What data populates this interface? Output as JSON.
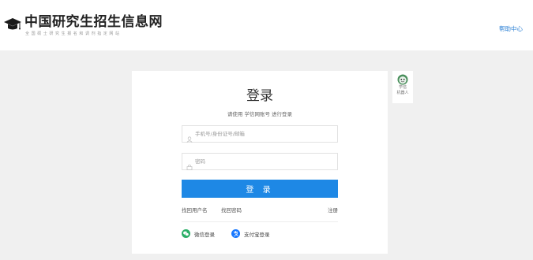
{
  "header": {
    "logo_title": "中国研究生招生信息网",
    "logo_subtitle": "全国硕士研究生报名和调剂指定网站",
    "help_link": "帮助中心"
  },
  "login": {
    "title": "登录",
    "subtitle": "请使用 学信网账号 进行登录",
    "username_placeholder": "手机号/身份证号/邮箱",
    "password_placeholder": "密码",
    "login_button": "登 录",
    "find_username": "找回用户名",
    "find_password": "找回密码",
    "register": "注册",
    "wechat_login": "微信登录",
    "alipay_login": "支付宝登录"
  },
  "robot": {
    "line1": "学信",
    "line2": "机器人"
  },
  "icons": {
    "logo": "mortarboard-icon",
    "user": "user-icon",
    "lock": "lock-icon",
    "wechat": "wechat-icon",
    "alipay": "alipay-icon",
    "robot": "robot-icon"
  },
  "colors": {
    "primary": "#1e88e5",
    "wechat": "#2aae67",
    "alipay": "#1677ff",
    "link": "#2a7fd4",
    "background": "#f0f0f0"
  }
}
